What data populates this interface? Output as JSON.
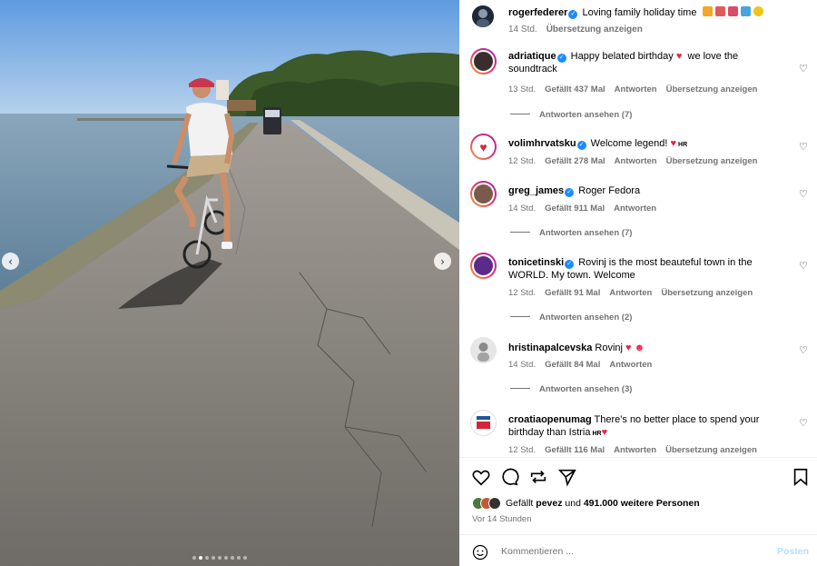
{
  "post": {
    "author": "rogerfederer",
    "caption": "Loving family holiday time",
    "caption_time": "14 Std.",
    "caption_translate": "Übersetzung anzeigen",
    "image_alt": "Man riding bicycle on a narrow causeway by the sea",
    "carousel_total": 9,
    "carousel_index": 2
  },
  "comments": [
    {
      "username": "adriatique",
      "verified": true,
      "text": "Happy belated birthday",
      "text_after": "we love the soundtrack",
      "time": "13 Std.",
      "likes": "Gefällt 437 Mal",
      "reply": "Antworten",
      "translate": "Übersetzung anzeigen",
      "view_replies": "Antworten ansehen (7)"
    },
    {
      "username": "volimhrvatsku",
      "verified": true,
      "text": "Welcome legend!",
      "tag": "HR",
      "time": "12 Std.",
      "likes": "Gefällt 278 Mal",
      "reply": "Antworten",
      "translate": "Übersetzung anzeigen"
    },
    {
      "username": "greg_james",
      "verified": true,
      "text": "Roger Fedora",
      "time": "14 Std.",
      "likes": "Gefällt 911 Mal",
      "reply": "Antworten",
      "view_replies": "Antworten ansehen (7)"
    },
    {
      "username": "tonicetinski",
      "verified": true,
      "text": "Rovinj is the most beauteful town in the WORLD. My town. Welcome",
      "time": "12 Std.",
      "likes": "Gefällt 91 Mal",
      "reply": "Antworten",
      "translate": "Übersetzung anzeigen",
      "view_replies": "Antworten ansehen (2)"
    },
    {
      "username": "hristinapalcevska",
      "verified": false,
      "text": "Rovinj",
      "time": "14 Std.",
      "likes": "Gefällt 84 Mal",
      "reply": "Antworten",
      "view_replies": "Antworten ansehen (3)"
    },
    {
      "username": "croatiaopenumag",
      "verified": false,
      "text": "There's no better place to spend your birthday than Istria",
      "tag": "HR",
      "time": "12 Std.",
      "likes": "Gefällt 116 Mal",
      "reply": "Antworten",
      "translate": "Übersetzung anzeigen"
    }
  ],
  "likes_summary": {
    "prefix": "Gefällt",
    "user": "pevez",
    "middle": "und",
    "count": "491.000 weitere Personen"
  },
  "time_ago": "Vor 14 Stunden",
  "comment_input": {
    "placeholder": "Kommentieren ..."
  },
  "post_button": "Posten",
  "colors": {
    "verified": "#1a8cff",
    "meta_gray": "#737373",
    "post_button": "#b2dffc",
    "heart_red": "#e8234b"
  },
  "icons": [
    "heart-icon",
    "comment-icon",
    "share-icon",
    "send-icon",
    "bookmark-icon",
    "smile-icon",
    "verified-icon",
    "chevron-left-icon",
    "chevron-right-icon"
  ]
}
